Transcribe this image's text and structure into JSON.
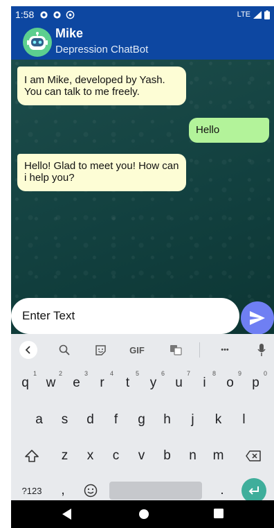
{
  "status_bar": {
    "time": "1:58",
    "network": "LTE",
    "icons": [
      "gear-icon",
      "gear-icon",
      "vpn-icon",
      "signal-icon",
      "battery-icon"
    ]
  },
  "app_bar": {
    "title": "Mike",
    "subtitle": "Depression ChatBot",
    "avatar_icon": "robot-icon"
  },
  "chat": {
    "messages": [
      {
        "sender": "bot",
        "text": "I am Mike, developed by Yash. You can talk to me freely."
      },
      {
        "sender": "user",
        "text": "Hello"
      },
      {
        "sender": "bot",
        "text": "Hello! Glad to meet you! How can i help you?"
      }
    ]
  },
  "input": {
    "placeholder": "Enter Text",
    "value": ""
  },
  "keyboard": {
    "toolbar": {
      "gif_label": "GIF",
      "more_label": "•••"
    },
    "row1": [
      {
        "key": "q",
        "hint": "1"
      },
      {
        "key": "w",
        "hint": "2"
      },
      {
        "key": "e",
        "hint": "3"
      },
      {
        "key": "r",
        "hint": "4"
      },
      {
        "key": "t",
        "hint": "5"
      },
      {
        "key": "y",
        "hint": "6"
      },
      {
        "key": "u",
        "hint": "7"
      },
      {
        "key": "i",
        "hint": "8"
      },
      {
        "key": "o",
        "hint": "9"
      },
      {
        "key": "p",
        "hint": "0"
      }
    ],
    "row2": [
      "a",
      "s",
      "d",
      "f",
      "g",
      "h",
      "j",
      "k",
      "l"
    ],
    "row3": [
      "z",
      "x",
      "c",
      "v",
      "b",
      "n",
      "m"
    ],
    "symbols_label": "?123",
    "comma_label": ",",
    "period_label": "."
  },
  "colors": {
    "app_bar": "#0d47a1",
    "bot_bubble": "#fdfdd5",
    "user_bubble": "#b3f39a",
    "send_button": "#6f7ff3",
    "enter_key": "#3fae9b"
  }
}
